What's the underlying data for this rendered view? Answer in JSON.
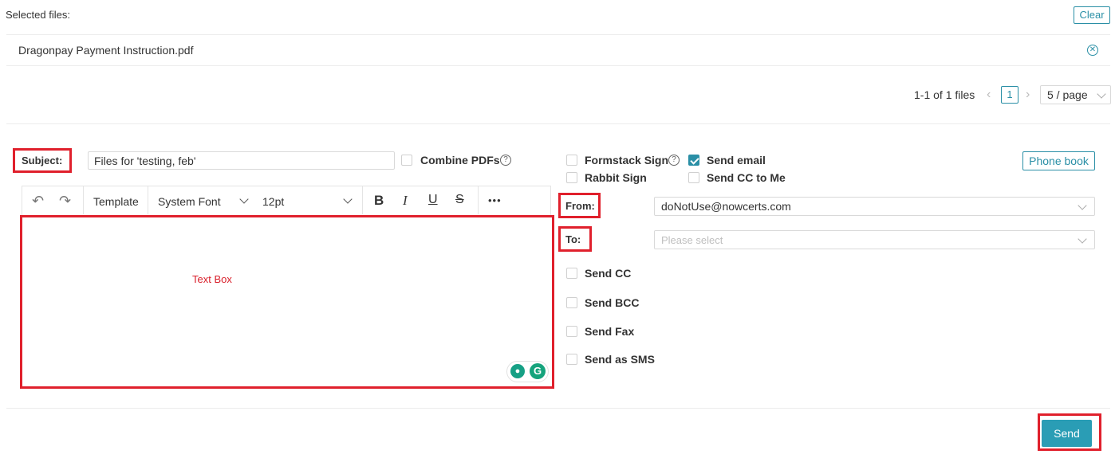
{
  "files": {
    "header_label": "Selected files:",
    "clear_label": "Clear",
    "items": [
      {
        "name": "Dragonpay Payment Instruction.pdf"
      }
    ],
    "pagination": {
      "summary": "1-1 of 1 files",
      "current_page": "1",
      "page_size": "5 / page"
    }
  },
  "form": {
    "subject_label": "Subject:",
    "subject_value": "Files for 'testing, feb'",
    "combine_pdfs_label": "Combine PDFs",
    "combine_pdfs_help": "?",
    "toolbar": {
      "template_label": "Template",
      "font_value": "System Font",
      "size_value": "12pt",
      "more_label": "•••"
    },
    "editor_label": "Text Box",
    "formstack_label": "Formstack Sign",
    "formstack_help": "?",
    "rabbit_label": "Rabbit Sign",
    "send_email_label": "Send email",
    "send_email_checked": true,
    "send_cc_me_label": "Send CC to Me",
    "phone_book_label": "Phone book",
    "from_label": "From:",
    "from_value": "doNotUse@nowcerts.com",
    "to_label": "To:",
    "to_placeholder": "Please select",
    "options": [
      {
        "label": "Send CC"
      },
      {
        "label": "Send BCC"
      },
      {
        "label": "Send Fax"
      },
      {
        "label": "Send as SMS"
      }
    ],
    "send_label": "Send"
  },
  "colors": {
    "accent": "#2a8fa6",
    "highlight": "#e0202c",
    "send_bg": "#2a9db5"
  }
}
